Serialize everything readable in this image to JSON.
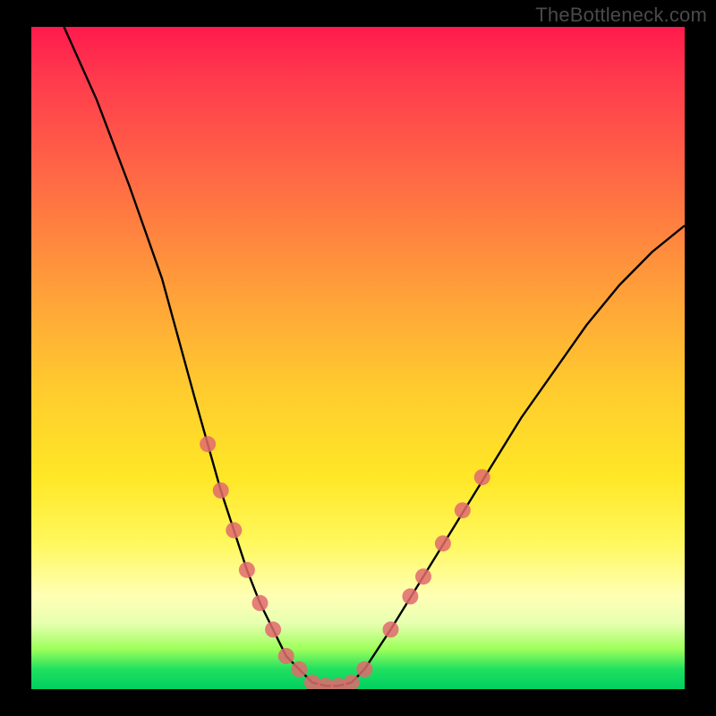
{
  "watermark": "TheBottleneck.com",
  "chart_data": {
    "type": "line",
    "title": "",
    "xlabel": "",
    "ylabel": "",
    "xlim": [
      0,
      100
    ],
    "ylim": [
      0,
      100
    ],
    "grid": false,
    "legend": false,
    "series": [
      {
        "name": "bottleneck-curve",
        "color": "#000000",
        "x": [
          5,
          10,
          15,
          20,
          25,
          27,
          29,
          31,
          33,
          35,
          37,
          39,
          41,
          43,
          45,
          47,
          49,
          51,
          55,
          60,
          65,
          70,
          75,
          80,
          85,
          90,
          95,
          100
        ],
        "y": [
          100,
          89,
          76,
          62,
          44,
          37,
          30,
          24,
          18,
          13,
          9,
          5,
          3,
          1,
          0.5,
          0.5,
          1,
          3,
          9,
          17,
          25,
          33,
          41,
          48,
          55,
          61,
          66,
          70
        ]
      }
    ],
    "markers": {
      "name": "highlighted-points",
      "color": "#e06a6d",
      "radius_px": 9,
      "points": [
        {
          "x": 27,
          "y": 37
        },
        {
          "x": 29,
          "y": 30
        },
        {
          "x": 31,
          "y": 24
        },
        {
          "x": 33,
          "y": 18
        },
        {
          "x": 35,
          "y": 13
        },
        {
          "x": 37,
          "y": 9
        },
        {
          "x": 39,
          "y": 5
        },
        {
          "x": 41,
          "y": 3
        },
        {
          "x": 43,
          "y": 1
        },
        {
          "x": 45,
          "y": 0.5
        },
        {
          "x": 47,
          "y": 0.5
        },
        {
          "x": 49,
          "y": 1
        },
        {
          "x": 51,
          "y": 3
        },
        {
          "x": 55,
          "y": 9
        },
        {
          "x": 58,
          "y": 14
        },
        {
          "x": 60,
          "y": 17
        },
        {
          "x": 63,
          "y": 22
        },
        {
          "x": 66,
          "y": 27
        },
        {
          "x": 69,
          "y": 32
        }
      ]
    },
    "background_gradient": {
      "top": "#ff1a4d",
      "mid": "#ffe726",
      "bottom": "#00d060"
    }
  }
}
